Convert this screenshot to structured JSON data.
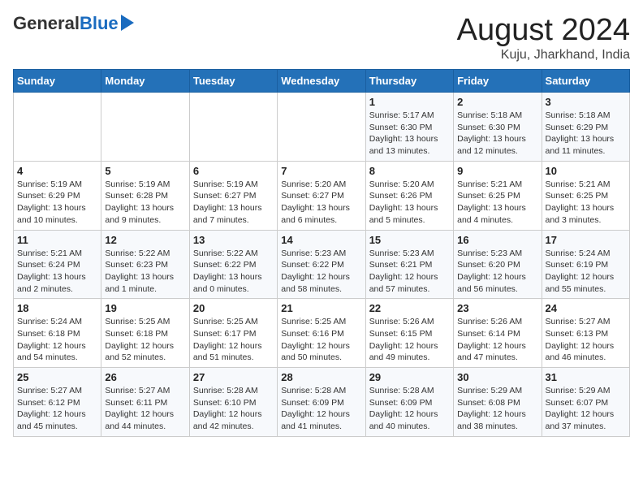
{
  "logo": {
    "general": "General",
    "blue": "Blue"
  },
  "title": {
    "month_year": "August 2024",
    "location": "Kuju, Jharkhand, India"
  },
  "weekdays": [
    "Sunday",
    "Monday",
    "Tuesday",
    "Wednesday",
    "Thursday",
    "Friday",
    "Saturday"
  ],
  "weeks": [
    [
      {
        "day": "",
        "info": ""
      },
      {
        "day": "",
        "info": ""
      },
      {
        "day": "",
        "info": ""
      },
      {
        "day": "",
        "info": ""
      },
      {
        "day": "1",
        "info": "Sunrise: 5:17 AM\nSunset: 6:30 PM\nDaylight: 13 hours\nand 13 minutes."
      },
      {
        "day": "2",
        "info": "Sunrise: 5:18 AM\nSunset: 6:30 PM\nDaylight: 13 hours\nand 12 minutes."
      },
      {
        "day": "3",
        "info": "Sunrise: 5:18 AM\nSunset: 6:29 PM\nDaylight: 13 hours\nand 11 minutes."
      }
    ],
    [
      {
        "day": "4",
        "info": "Sunrise: 5:19 AM\nSunset: 6:29 PM\nDaylight: 13 hours\nand 10 minutes."
      },
      {
        "day": "5",
        "info": "Sunrise: 5:19 AM\nSunset: 6:28 PM\nDaylight: 13 hours\nand 9 minutes."
      },
      {
        "day": "6",
        "info": "Sunrise: 5:19 AM\nSunset: 6:27 PM\nDaylight: 13 hours\nand 7 minutes."
      },
      {
        "day": "7",
        "info": "Sunrise: 5:20 AM\nSunset: 6:27 PM\nDaylight: 13 hours\nand 6 minutes."
      },
      {
        "day": "8",
        "info": "Sunrise: 5:20 AM\nSunset: 6:26 PM\nDaylight: 13 hours\nand 5 minutes."
      },
      {
        "day": "9",
        "info": "Sunrise: 5:21 AM\nSunset: 6:25 PM\nDaylight: 13 hours\nand 4 minutes."
      },
      {
        "day": "10",
        "info": "Sunrise: 5:21 AM\nSunset: 6:25 PM\nDaylight: 13 hours\nand 3 minutes."
      }
    ],
    [
      {
        "day": "11",
        "info": "Sunrise: 5:21 AM\nSunset: 6:24 PM\nDaylight: 13 hours\nand 2 minutes."
      },
      {
        "day": "12",
        "info": "Sunrise: 5:22 AM\nSunset: 6:23 PM\nDaylight: 13 hours\nand 1 minute."
      },
      {
        "day": "13",
        "info": "Sunrise: 5:22 AM\nSunset: 6:22 PM\nDaylight: 13 hours\nand 0 minutes."
      },
      {
        "day": "14",
        "info": "Sunrise: 5:23 AM\nSunset: 6:22 PM\nDaylight: 12 hours\nand 58 minutes."
      },
      {
        "day": "15",
        "info": "Sunrise: 5:23 AM\nSunset: 6:21 PM\nDaylight: 12 hours\nand 57 minutes."
      },
      {
        "day": "16",
        "info": "Sunrise: 5:23 AM\nSunset: 6:20 PM\nDaylight: 12 hours\nand 56 minutes."
      },
      {
        "day": "17",
        "info": "Sunrise: 5:24 AM\nSunset: 6:19 PM\nDaylight: 12 hours\nand 55 minutes."
      }
    ],
    [
      {
        "day": "18",
        "info": "Sunrise: 5:24 AM\nSunset: 6:18 PM\nDaylight: 12 hours\nand 54 minutes."
      },
      {
        "day": "19",
        "info": "Sunrise: 5:25 AM\nSunset: 6:18 PM\nDaylight: 12 hours\nand 52 minutes."
      },
      {
        "day": "20",
        "info": "Sunrise: 5:25 AM\nSunset: 6:17 PM\nDaylight: 12 hours\nand 51 minutes."
      },
      {
        "day": "21",
        "info": "Sunrise: 5:25 AM\nSunset: 6:16 PM\nDaylight: 12 hours\nand 50 minutes."
      },
      {
        "day": "22",
        "info": "Sunrise: 5:26 AM\nSunset: 6:15 PM\nDaylight: 12 hours\nand 49 minutes."
      },
      {
        "day": "23",
        "info": "Sunrise: 5:26 AM\nSunset: 6:14 PM\nDaylight: 12 hours\nand 47 minutes."
      },
      {
        "day": "24",
        "info": "Sunrise: 5:27 AM\nSunset: 6:13 PM\nDaylight: 12 hours\nand 46 minutes."
      }
    ],
    [
      {
        "day": "25",
        "info": "Sunrise: 5:27 AM\nSunset: 6:12 PM\nDaylight: 12 hours\nand 45 minutes."
      },
      {
        "day": "26",
        "info": "Sunrise: 5:27 AM\nSunset: 6:11 PM\nDaylight: 12 hours\nand 44 minutes."
      },
      {
        "day": "27",
        "info": "Sunrise: 5:28 AM\nSunset: 6:10 PM\nDaylight: 12 hours\nand 42 minutes."
      },
      {
        "day": "28",
        "info": "Sunrise: 5:28 AM\nSunset: 6:09 PM\nDaylight: 12 hours\nand 41 minutes."
      },
      {
        "day": "29",
        "info": "Sunrise: 5:28 AM\nSunset: 6:09 PM\nDaylight: 12 hours\nand 40 minutes."
      },
      {
        "day": "30",
        "info": "Sunrise: 5:29 AM\nSunset: 6:08 PM\nDaylight: 12 hours\nand 38 minutes."
      },
      {
        "day": "31",
        "info": "Sunrise: 5:29 AM\nSunset: 6:07 PM\nDaylight: 12 hours\nand 37 minutes."
      }
    ]
  ]
}
